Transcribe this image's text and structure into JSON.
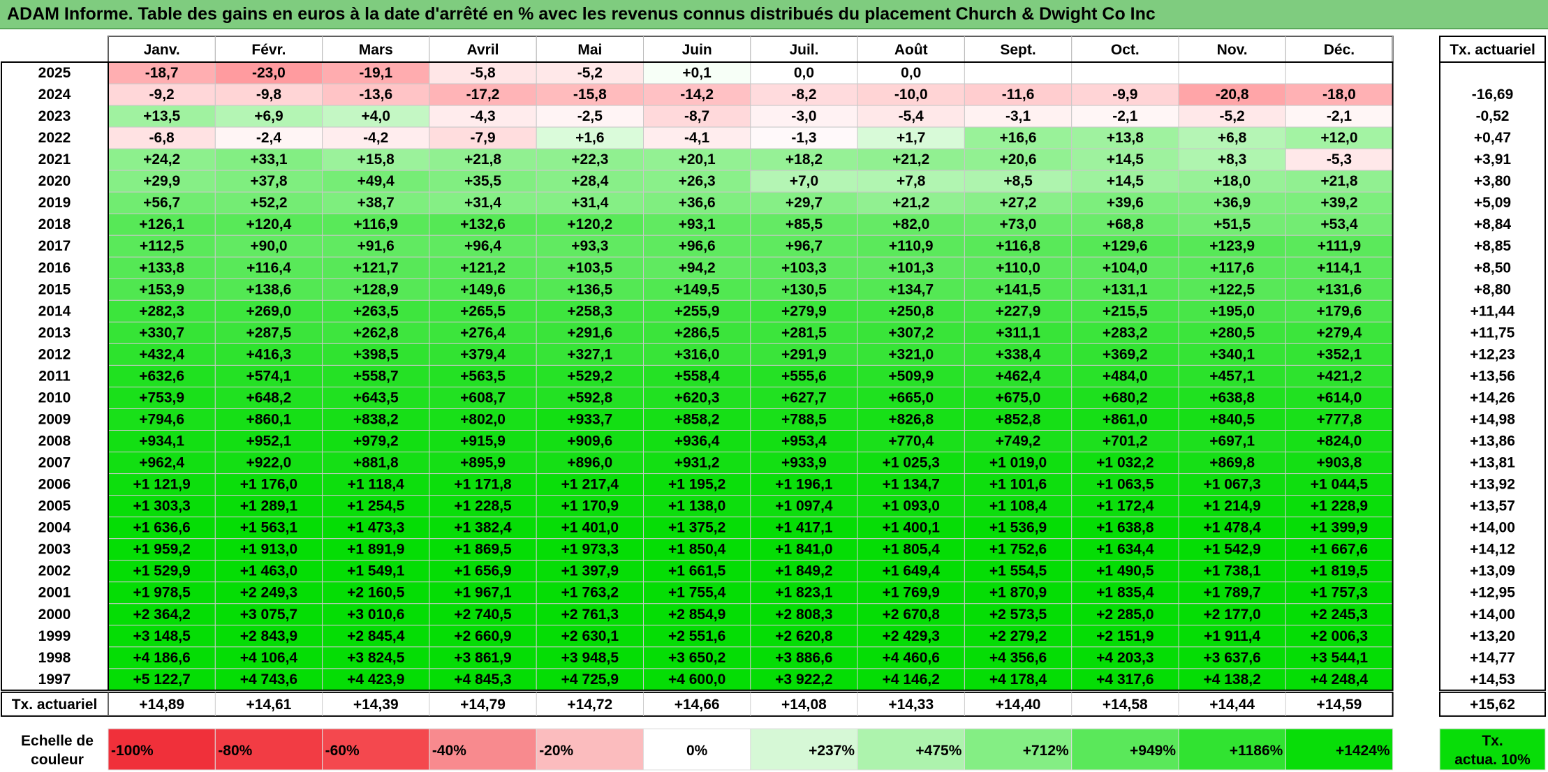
{
  "title": "ADAM Informe. Table des gains en euros à la date d'arrêté en % avec les revenus connus distribués du placement Church & Dwight Co Inc",
  "chart_data": {
    "type": "table",
    "title": "ADAM Informe. Table des gains en euros à la date d'arrêté en % avec les revenus connus distribués du placement Church & Dwight Co Inc",
    "columns": [
      "Janv.",
      "Févr.",
      "Mars",
      "Avril",
      "Mai",
      "Juin",
      "Juil.",
      "Août",
      "Sept.",
      "Oct.",
      "Nov.",
      "Déc."
    ],
    "rate_header": "Tx. actuariel",
    "rows": [
      {
        "year": "2025",
        "values": [
          "-18,7",
          "-23,0",
          "-19,1",
          "-5,8",
          "-5,2",
          "+0,1",
          "0,0",
          "0,0",
          "",
          "",
          "",
          ""
        ],
        "rate": ""
      },
      {
        "year": "2024",
        "values": [
          "-9,2",
          "-9,8",
          "-13,6",
          "-17,2",
          "-15,8",
          "-14,2",
          "-8,2",
          "-10,0",
          "-11,6",
          "-9,9",
          "-20,8",
          "-18,0"
        ],
        "rate": "-16,69"
      },
      {
        "year": "2023",
        "values": [
          "+13,5",
          "+6,9",
          "+4,0",
          "-4,3",
          "-2,5",
          "-8,7",
          "-3,0",
          "-5,4",
          "-3,1",
          "-2,1",
          "-5,2",
          "-2,1"
        ],
        "rate": "-0,52"
      },
      {
        "year": "2022",
        "values": [
          "-6,8",
          "-2,4",
          "-4,2",
          "-7,9",
          "+1,6",
          "-4,1",
          "-1,3",
          "+1,7",
          "+16,6",
          "+13,8",
          "+6,8",
          "+12,0"
        ],
        "rate": "+0,47"
      },
      {
        "year": "2021",
        "values": [
          "+24,2",
          "+33,1",
          "+15,8",
          "+21,8",
          "+22,3",
          "+20,1",
          "+18,2",
          "+21,2",
          "+20,6",
          "+14,5",
          "+8,3",
          "-5,3"
        ],
        "rate": "+3,91"
      },
      {
        "year": "2020",
        "values": [
          "+29,9",
          "+37,8",
          "+49,4",
          "+35,5",
          "+28,4",
          "+26,3",
          "+7,0",
          "+7,8",
          "+8,5",
          "+14,5",
          "+18,0",
          "+21,8"
        ],
        "rate": "+3,80"
      },
      {
        "year": "2019",
        "values": [
          "+56,7",
          "+52,2",
          "+38,7",
          "+31,4",
          "+31,4",
          "+36,6",
          "+29,7",
          "+21,2",
          "+27,2",
          "+39,6",
          "+36,9",
          "+39,2"
        ],
        "rate": "+5,09"
      },
      {
        "year": "2018",
        "values": [
          "+126,1",
          "+120,4",
          "+116,9",
          "+132,6",
          "+120,2",
          "+93,1",
          "+85,5",
          "+82,0",
          "+73,0",
          "+68,8",
          "+51,5",
          "+53,4"
        ],
        "rate": "+8,84"
      },
      {
        "year": "2017",
        "values": [
          "+112,5",
          "+90,0",
          "+91,6",
          "+96,4",
          "+93,3",
          "+96,6",
          "+96,7",
          "+110,9",
          "+116,8",
          "+129,6",
          "+123,9",
          "+111,9"
        ],
        "rate": "+8,85"
      },
      {
        "year": "2016",
        "values": [
          "+133,8",
          "+116,4",
          "+121,7",
          "+121,2",
          "+103,5",
          "+94,2",
          "+103,3",
          "+101,3",
          "+110,0",
          "+104,0",
          "+117,6",
          "+114,1"
        ],
        "rate": "+8,50"
      },
      {
        "year": "2015",
        "values": [
          "+153,9",
          "+138,6",
          "+128,9",
          "+149,6",
          "+136,5",
          "+149,5",
          "+130,5",
          "+134,7",
          "+141,5",
          "+131,1",
          "+122,5",
          "+131,6"
        ],
        "rate": "+8,80"
      },
      {
        "year": "2014",
        "values": [
          "+282,3",
          "+269,0",
          "+263,5",
          "+265,5",
          "+258,3",
          "+255,9",
          "+279,9",
          "+250,8",
          "+227,9",
          "+215,5",
          "+195,0",
          "+179,6"
        ],
        "rate": "+11,44"
      },
      {
        "year": "2013",
        "values": [
          "+330,7",
          "+287,5",
          "+262,8",
          "+276,4",
          "+291,6",
          "+286,5",
          "+281,5",
          "+307,2",
          "+311,1",
          "+283,2",
          "+280,5",
          "+279,4"
        ],
        "rate": "+11,75"
      },
      {
        "year": "2012",
        "values": [
          "+432,4",
          "+416,3",
          "+398,5",
          "+379,4",
          "+327,1",
          "+316,0",
          "+291,9",
          "+321,0",
          "+338,4",
          "+369,2",
          "+340,1",
          "+352,1"
        ],
        "rate": "+12,23"
      },
      {
        "year": "2011",
        "values": [
          "+632,6",
          "+574,1",
          "+558,7",
          "+563,5",
          "+529,2",
          "+558,4",
          "+555,6",
          "+509,9",
          "+462,4",
          "+484,0",
          "+457,1",
          "+421,2"
        ],
        "rate": "+13,56"
      },
      {
        "year": "2010",
        "values": [
          "+753,9",
          "+648,2",
          "+643,5",
          "+608,7",
          "+592,8",
          "+620,3",
          "+627,7",
          "+665,0",
          "+675,0",
          "+680,2",
          "+638,8",
          "+614,0"
        ],
        "rate": "+14,26"
      },
      {
        "year": "2009",
        "values": [
          "+794,6",
          "+860,1",
          "+838,2",
          "+802,0",
          "+933,7",
          "+858,2",
          "+788,5",
          "+826,8",
          "+852,8",
          "+861,0",
          "+840,5",
          "+777,8"
        ],
        "rate": "+14,98"
      },
      {
        "year": "2008",
        "values": [
          "+934,1",
          "+952,1",
          "+979,2",
          "+915,9",
          "+909,6",
          "+936,4",
          "+953,4",
          "+770,4",
          "+749,2",
          "+701,2",
          "+697,1",
          "+824,0"
        ],
        "rate": "+13,86"
      },
      {
        "year": "2007",
        "values": [
          "+962,4",
          "+922,0",
          "+881,8",
          "+895,9",
          "+896,0",
          "+931,2",
          "+933,9",
          "+1 025,3",
          "+1 019,0",
          "+1 032,2",
          "+869,8",
          "+903,8"
        ],
        "rate": "+13,81"
      },
      {
        "year": "2006",
        "values": [
          "+1 121,9",
          "+1 176,0",
          "+1 118,4",
          "+1 171,8",
          "+1 217,4",
          "+1 195,2",
          "+1 196,1",
          "+1 134,7",
          "+1 101,6",
          "+1 063,5",
          "+1 067,3",
          "+1 044,5"
        ],
        "rate": "+13,92"
      },
      {
        "year": "2005",
        "values": [
          "+1 303,3",
          "+1 289,1",
          "+1 254,5",
          "+1 228,5",
          "+1 170,9",
          "+1 138,0",
          "+1 097,4",
          "+1 093,0",
          "+1 108,4",
          "+1 172,4",
          "+1 214,9",
          "+1 228,9"
        ],
        "rate": "+13,57"
      },
      {
        "year": "2004",
        "values": [
          "+1 636,6",
          "+1 563,1",
          "+1 473,3",
          "+1 382,4",
          "+1 401,0",
          "+1 375,2",
          "+1 417,1",
          "+1 400,1",
          "+1 536,9",
          "+1 638,8",
          "+1 478,4",
          "+1 399,9"
        ],
        "rate": "+14,00"
      },
      {
        "year": "2003",
        "values": [
          "+1 959,2",
          "+1 913,0",
          "+1 891,9",
          "+1 869,5",
          "+1 973,3",
          "+1 850,4",
          "+1 841,0",
          "+1 805,4",
          "+1 752,6",
          "+1 634,4",
          "+1 542,9",
          "+1 667,6"
        ],
        "rate": "+14,12"
      },
      {
        "year": "2002",
        "values": [
          "+1 529,9",
          "+1 463,0",
          "+1 549,1",
          "+1 656,9",
          "+1 397,9",
          "+1 661,5",
          "+1 849,2",
          "+1 649,4",
          "+1 554,5",
          "+1 490,5",
          "+1 738,1",
          "+1 819,5"
        ],
        "rate": "+13,09"
      },
      {
        "year": "2001",
        "values": [
          "+1 978,5",
          "+2 249,3",
          "+2 160,5",
          "+1 967,1",
          "+1 763,2",
          "+1 755,4",
          "+1 823,1",
          "+1 769,9",
          "+1 870,9",
          "+1 835,4",
          "+1 789,7",
          "+1 757,3"
        ],
        "rate": "+12,95"
      },
      {
        "year": "2000",
        "values": [
          "+2 364,2",
          "+3 075,7",
          "+3 010,6",
          "+2 740,5",
          "+2 761,3",
          "+2 854,9",
          "+2 808,3",
          "+2 670,8",
          "+2 573,5",
          "+2 285,0",
          "+2 177,0",
          "+2 245,3"
        ],
        "rate": "+14,00"
      },
      {
        "year": "1999",
        "values": [
          "+3 148,5",
          "+2 843,9",
          "+2 845,4",
          "+2 660,9",
          "+2 630,1",
          "+2 551,6",
          "+2 620,8",
          "+2 429,3",
          "+2 279,2",
          "+2 151,9",
          "+1 911,4",
          "+2 006,3"
        ],
        "rate": "+13,20"
      },
      {
        "year": "1998",
        "values": [
          "+4 186,6",
          "+4 106,4",
          "+3 824,5",
          "+3 861,9",
          "+3 948,5",
          "+3 650,2",
          "+3 886,6",
          "+4 460,6",
          "+4 356,6",
          "+4 203,3",
          "+3 637,6",
          "+3 544,1"
        ],
        "rate": "+14,77"
      },
      {
        "year": "1997",
        "values": [
          "+5 122,7",
          "+4 743,6",
          "+4 423,9",
          "+4 845,3",
          "+4 725,9",
          "+4 600,0",
          "+3 922,2",
          "+4 146,2",
          "+4 178,4",
          "+4 317,6",
          "+4 138,2",
          "+4 248,4"
        ],
        "rate": "+14,53"
      }
    ],
    "footer": {
      "label": "Tx. actuariel",
      "values": [
        "+14,89",
        "+14,61",
        "+14,39",
        "+14,79",
        "+14,72",
        "+14,66",
        "+14,08",
        "+14,33",
        "+14,40",
        "+14,58",
        "+14,44",
        "+14,59"
      ],
      "overall": "+15,62"
    },
    "legend": {
      "label_line1": "Echelle de",
      "label_line2": "couleur",
      "scale": [
        {
          "label": "-100%",
          "color": "#f0303a"
        },
        {
          "label": "-80%",
          "color": "#f23c44"
        },
        {
          "label": "-60%",
          "color": "#f4484e"
        },
        {
          "label": "-40%",
          "color": "#f88a8e"
        },
        {
          "label": "-20%",
          "color": "#fbbcbe"
        },
        {
          "label": "0%",
          "color": "#ffffff"
        },
        {
          "label": "+237%",
          "color": "#d6f8d6"
        },
        {
          "label": "+475%",
          "color": "#adf3ad"
        },
        {
          "label": "+712%",
          "color": "#84ee84"
        },
        {
          "label": "+949%",
          "color": "#5ae85a"
        },
        {
          "label": "+1186%",
          "color": "#31e331"
        },
        {
          "label": "+1424%",
          "color": "#08dd08"
        }
      ],
      "rate_line1": "Tx.",
      "rate_line2": "actua. 10%",
      "rate_color": "#08dd08"
    }
  }
}
